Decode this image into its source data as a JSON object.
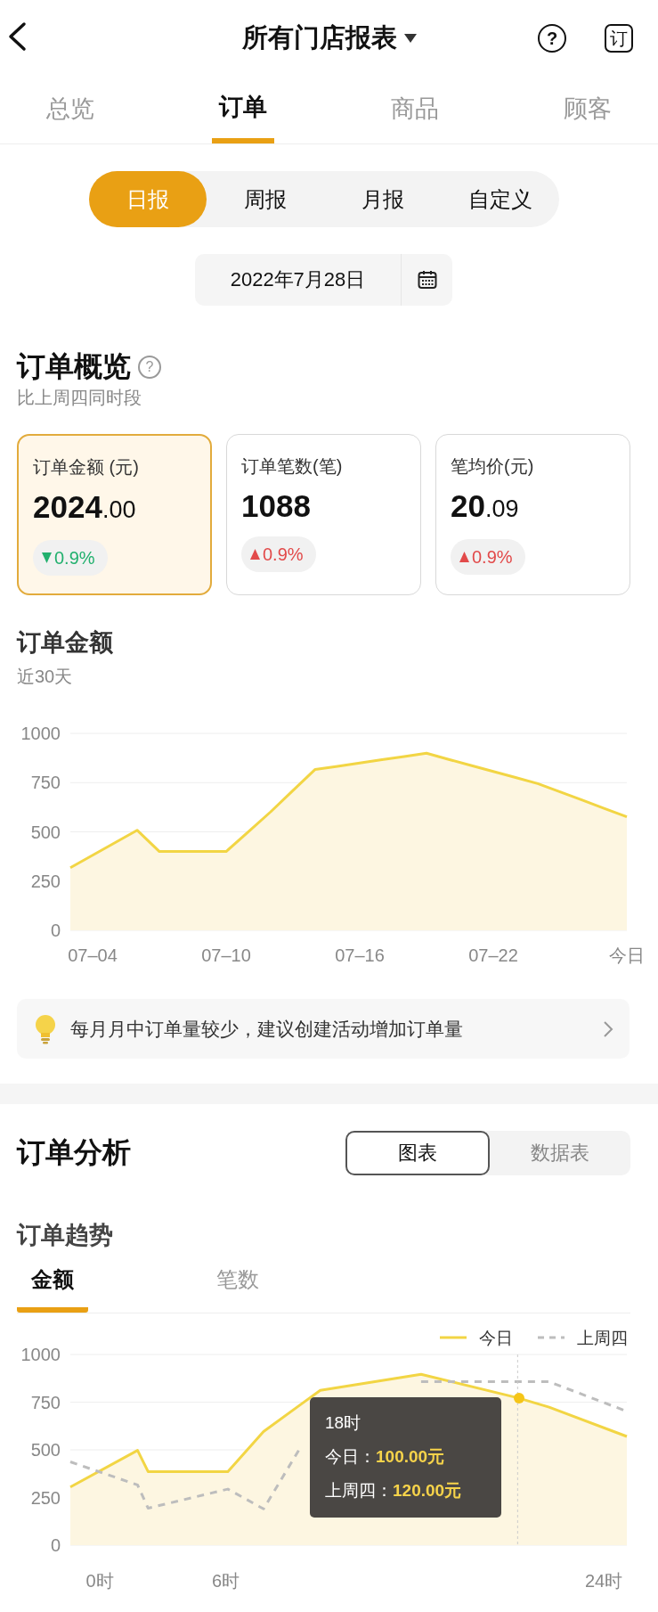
{
  "header": {
    "title": "所有门店报表",
    "help_label": "?",
    "order_label": "订"
  },
  "tabs": [
    {
      "label": "总览",
      "selected": false
    },
    {
      "label": "订单",
      "selected": true
    },
    {
      "label": "商品",
      "selected": false
    },
    {
      "label": "顾客",
      "selected": false
    }
  ],
  "periods": [
    {
      "label": "日报",
      "selected": true
    },
    {
      "label": "周报",
      "selected": false
    },
    {
      "label": "月报",
      "selected": false
    },
    {
      "label": "自定义",
      "selected": false
    }
  ],
  "date": "2022年7月28日",
  "overview": {
    "title": "订单概览",
    "help_label": "?",
    "subtitle": "比上周四同时段",
    "cards": [
      {
        "label": "订单金额 (元)",
        "value": "2024",
        "decimals": ".00",
        "increase": false,
        "change": "0.9%",
        "selected": true
      },
      {
        "label": "订单笔数(笔)",
        "value": "1088",
        "increase": true,
        "change": "0.9%",
        "selected": false
      },
      {
        "label": "笔均价(元)",
        "value": "20",
        "decimals": ".09",
        "increase": true,
        "change": "0.9%",
        "selected": false
      }
    ]
  },
  "amount": {
    "title": "订单金额",
    "subtitle": "近30天",
    "chart_data": {
      "type": "area",
      "categories": [
        null,
        "07–04",
        null,
        null,
        null,
        null,
        null,
        "07–10",
        null,
        null,
        null,
        null,
        null,
        "07–16",
        null,
        null,
        null,
        null,
        null,
        "07–22",
        null,
        null,
        null,
        null,
        null,
        "今日"
      ],
      "series": [
        {
          "color": "#f2d544",
          "values": [
            318,
            381,
            445,
            508,
            400,
            400,
            400,
            400,
            501,
            602,
            710,
            817,
            833,
            850,
            866,
            883,
            899,
            868,
            837,
            807,
            776,
            745,
            703,
            661,
            618,
            576
          ]
        }
      ],
      "ylim": [
        0,
        1000
      ],
      "yticks": [
        0,
        250,
        500,
        750,
        1000
      ]
    }
  },
  "tip": "每月月中订单量较少，建议创建活动增加订单量",
  "analysis": {
    "title": "订单分析",
    "views": [
      {
        "label": "图表",
        "selected": true
      },
      {
        "label": "数据表",
        "selected": false
      }
    ],
    "trend_title": "订单趋势",
    "metrics": [
      {
        "label": "金额",
        "selected": true
      },
      {
        "label": "笔数",
        "selected": false
      }
    ],
    "chart_data": {
      "type": "line",
      "legend": "upper right",
      "x": [
        -1.4,
        1.8,
        2.3,
        6.1,
        7.8,
        9.6,
        10.5,
        15.3,
        19.9,
        21.4,
        25.1
      ],
      "series": [
        {
          "name": "今日",
          "type": "area",
          "line_style": "solid",
          "color": "#f2d544",
          "values": [
            305,
            497,
            386,
            386,
            596,
            740,
            812,
            896,
            773,
            724,
            570
          ]
        },
        {
          "name": "上周四",
          "line_style": "dashed",
          "color": "#bdbdbd",
          "values": [
            437,
            316,
            194,
            294,
            190,
            520,
            null,
            857,
            857,
            857,
            702
          ]
        }
      ],
      "ylim": [
        0,
        1000
      ],
      "yticks": [
        0,
        250,
        500,
        750,
        1000
      ],
      "xlim": [
        -1.4,
        25.1
      ],
      "xticks": [
        {
          "value": 0,
          "label": "0时"
        },
        {
          "value": 6,
          "label": "6时"
        },
        {
          "value": 24,
          "label": "24时"
        }
      ],
      "ref_lines": [
        {
          "axis": "x",
          "value": 19.9
        }
      ]
    },
    "tooltip": {
      "title": "18时",
      "rows": [
        {
          "label": "今日：",
          "value": "100.00元"
        },
        {
          "label": "上周四：",
          "value": "120.00元"
        }
      ]
    }
  }
}
